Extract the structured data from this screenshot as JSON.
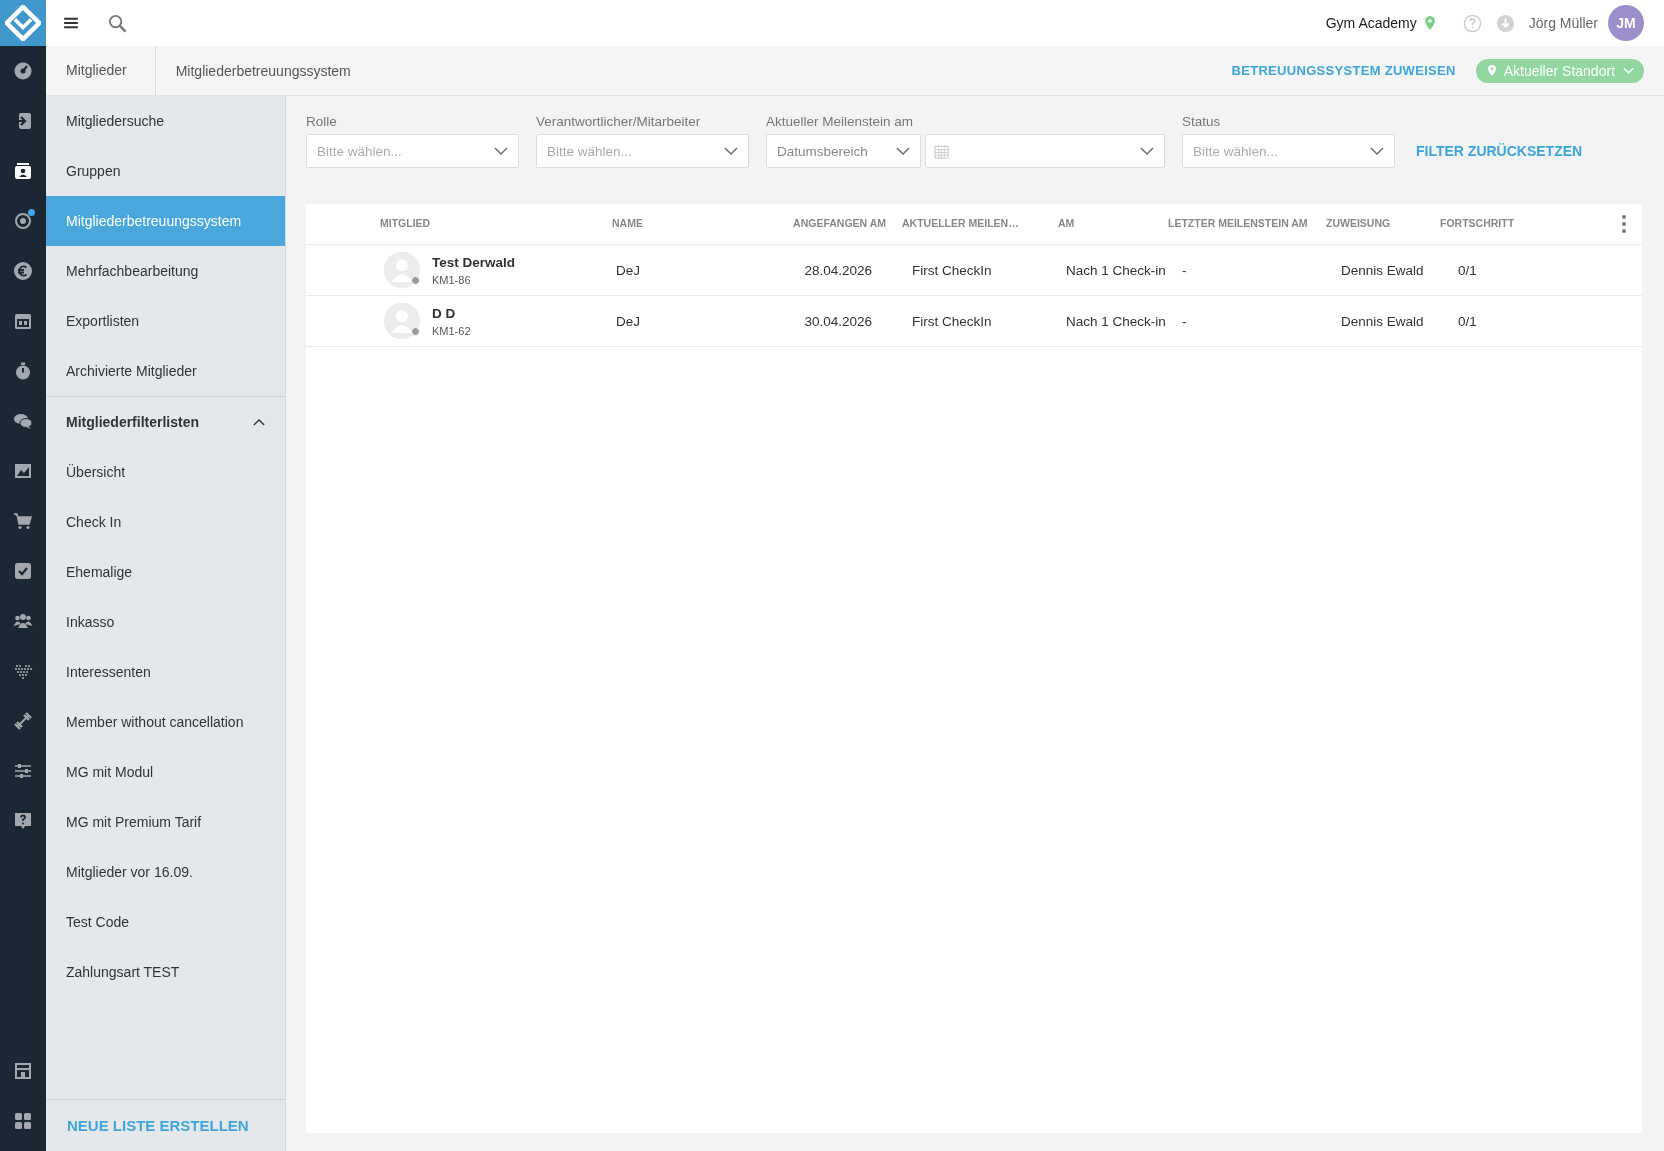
{
  "rail": {
    "top": [
      {
        "kind": "dashboard",
        "selected": false,
        "dot": false
      },
      {
        "kind": "login",
        "selected": false,
        "dot": false
      },
      {
        "kind": "member-card",
        "selected": true,
        "dot": false
      },
      {
        "kind": "target",
        "selected": false,
        "dot": true
      },
      {
        "kind": "euro",
        "selected": false,
        "dot": false
      },
      {
        "kind": "calendar",
        "selected": false,
        "dot": false
      },
      {
        "kind": "stopwatch",
        "selected": false,
        "dot": false
      },
      {
        "kind": "chat",
        "selected": false,
        "dot": false
      },
      {
        "kind": "image",
        "selected": false,
        "dot": false
      },
      {
        "kind": "cart",
        "selected": false,
        "dot": false
      },
      {
        "kind": "checkbox",
        "selected": false,
        "dot": false
      },
      {
        "kind": "group",
        "selected": false,
        "dot": false
      },
      {
        "kind": "dots-heart",
        "selected": false,
        "dot": false
      },
      {
        "kind": "dumbbell",
        "selected": false,
        "dot": false
      },
      {
        "kind": "sliders",
        "selected": false,
        "dot": false
      },
      {
        "kind": "help",
        "selected": false,
        "dot": false
      }
    ],
    "bottom": [
      {
        "kind": "shop",
        "selected": false,
        "dot": false
      },
      {
        "kind": "grid",
        "selected": false,
        "dot": false
      }
    ]
  },
  "topbar": {
    "studio": "Gym Academy",
    "user": "Jörg Müller",
    "initials": "JM"
  },
  "breadcrumbs": [
    "Mitglieder",
    "Mitgliederbetreuungssystem"
  ],
  "actions": {
    "assign": "BETREUUNGSSYSTEM ZUWEISEN",
    "location": "Aktueller Standort"
  },
  "sidebar": {
    "items": [
      {
        "label": "Mitgliedersuche",
        "selected": false
      },
      {
        "label": "Gruppen",
        "selected": false
      },
      {
        "label": "Mitgliederbetreuungssystem",
        "selected": true
      },
      {
        "label": "Mehrfachbearbeitung",
        "selected": false
      },
      {
        "label": "Exportlisten",
        "selected": false
      },
      {
        "label": "Archivierte Mitglieder",
        "selected": false
      }
    ],
    "section": {
      "title": "Mitgliederfilterlisten",
      "expanded": true,
      "items": [
        {
          "label": "Übersicht",
          "selected": false
        },
        {
          "label": "Check In",
          "selected": false
        },
        {
          "label": "Ehemalige",
          "selected": false
        },
        {
          "label": "Inkasso",
          "selected": false
        },
        {
          "label": "Interessenten",
          "selected": false
        },
        {
          "label": "Member without cancellation",
          "selected": false
        },
        {
          "label": "MG mit Modul",
          "selected": false
        },
        {
          "label": "MG mit Premium Tarif",
          "selected": false
        },
        {
          "label": "Mitglieder vor 16.09.",
          "selected": false
        },
        {
          "label": "Test Code",
          "selected": false
        },
        {
          "label": "Zahlungsart TEST",
          "selected": false
        }
      ]
    },
    "create_button": "NEUE LISTE ERSTELLEN"
  },
  "filters": [
    {
      "kind": "select",
      "label": "Rolle",
      "placeholder": "Bitte wählen..."
    },
    {
      "kind": "select",
      "label": "Verantwortlicher/Mitarbeiter",
      "placeholder": "Bitte wählen..."
    },
    {
      "kind": "daterange",
      "label": "Aktueller Meilenstein am",
      "placeholder": "Datumsbereich"
    },
    {
      "kind": "select",
      "label": "Status",
      "placeholder": "Bitte wählen..."
    }
  ],
  "reset": "FILTER ZURÜCKSETZEN",
  "table": {
    "columns": [
      "MITGLIED",
      "NAME",
      "ANGEFANGEN AM",
      "AKTUELLER MEILEN…",
      "AM",
      "LETZTER MEILENSTEIN AM",
      "ZUWEISUNG",
      "FORTSCHRITT"
    ],
    "rows": [
      {
        "member": "Test Derwald",
        "number": "KM1-86",
        "name": "DeJ",
        "started": "28.04.2026",
        "current": "First CheckIn",
        "am": "Nach 1 Check-in",
        "last": "-",
        "assignee": "Dennis Ewald",
        "progress": "0/1"
      },
      {
        "member": "D D",
        "number": "KM1-62",
        "name": "DeJ",
        "started": "30.04.2026",
        "current": "First CheckIn",
        "am": "Nach 1 Check-in",
        "last": "-",
        "assignee": "Dennis Ewald",
        "progress": "0/1"
      }
    ]
  }
}
